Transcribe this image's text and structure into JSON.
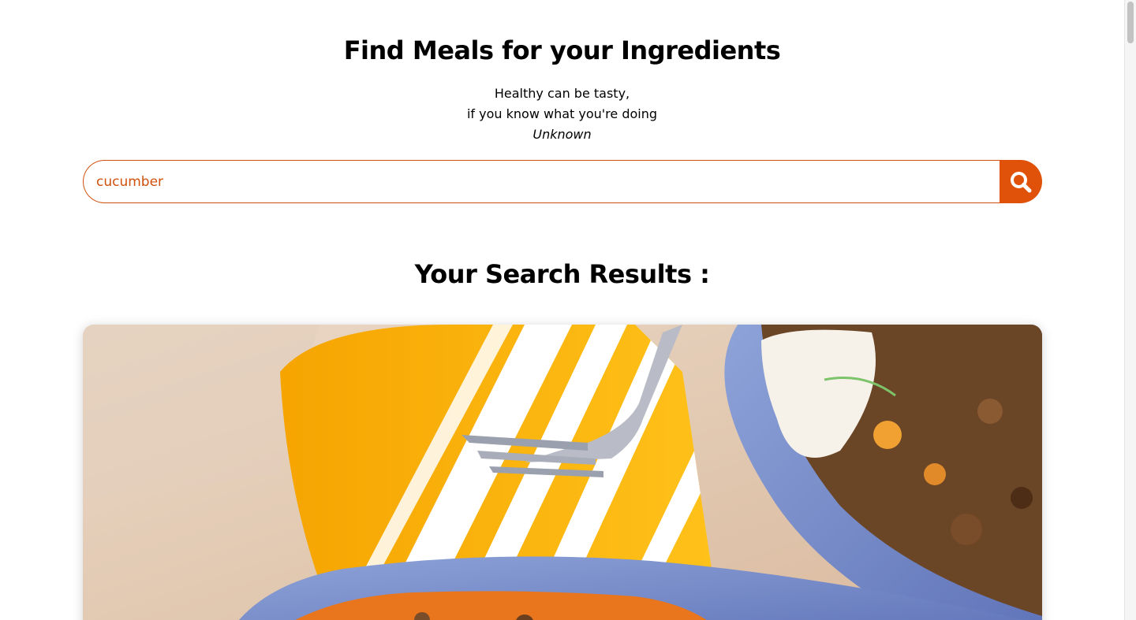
{
  "header": {
    "title": "Find Meals for your Ingredients"
  },
  "quote": {
    "line1": "Healthy can be tasty,",
    "line2": "if you know what you're doing",
    "author": "Unknown"
  },
  "search": {
    "value": "cucumber",
    "button_icon": "search-icon"
  },
  "results": {
    "title": "Your Search Results :"
  },
  "colors": {
    "accent": "#e0520a",
    "input_border": "#d0500c",
    "input_text": "#d0500c"
  }
}
